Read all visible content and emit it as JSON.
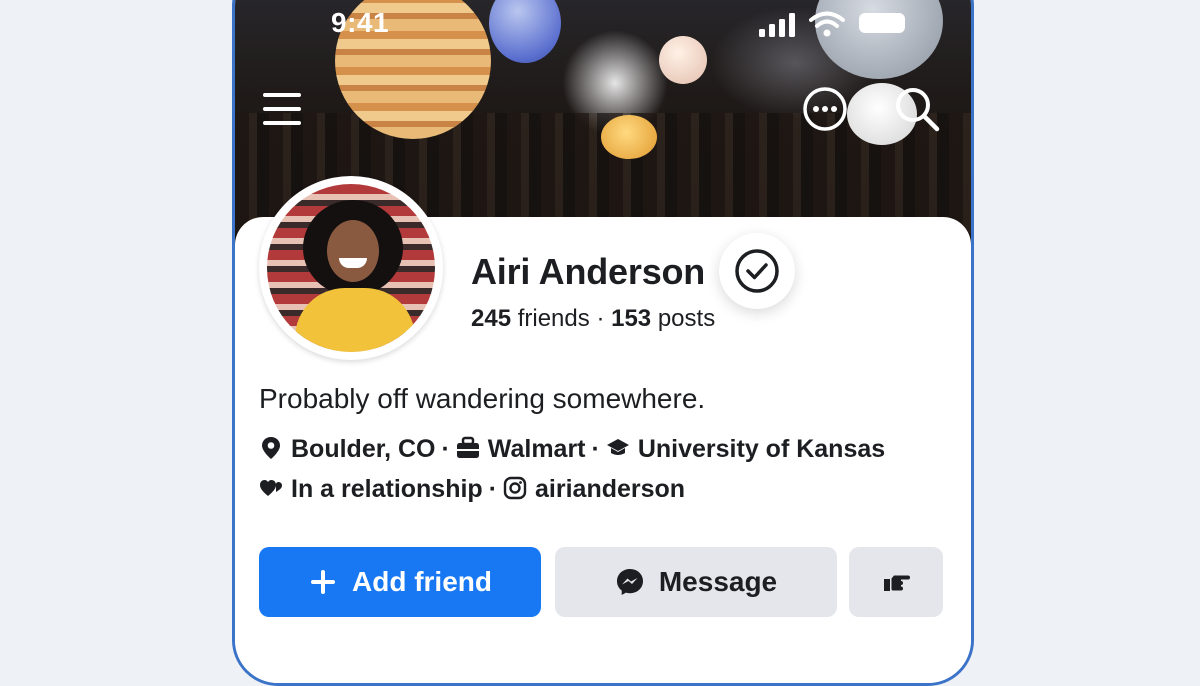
{
  "status_bar": {
    "time": "9:41"
  },
  "profile": {
    "name": "Airi Anderson",
    "friends_count": "245",
    "friends_label": "friends",
    "separator": "·",
    "posts_count": "153",
    "posts_label": "posts",
    "bio": "Probably off wandering somewhere.",
    "details": {
      "location": "Boulder, CO",
      "work": "Walmart",
      "education": "University of Kansas",
      "relationship": "In a relationship",
      "instagram": "airianderson"
    }
  },
  "actions": {
    "add_friend_label": "Add friend",
    "message_label": "Message"
  },
  "icons": {
    "menu": "menu-icon",
    "more": "more-icon",
    "search": "search-icon",
    "verified": "verified-check-icon",
    "location": "location-pin-icon",
    "work": "briefcase-icon",
    "education": "graduation-cap-icon",
    "relationship": "hearts-icon",
    "instagram": "instagram-icon",
    "add": "plus-icon",
    "messenger": "messenger-icon",
    "poke": "poke-hand-icon"
  },
  "colors": {
    "primary": "#1877f2",
    "secondary_button": "#e4e6eb",
    "text": "#1c1e21",
    "phone_frame": "#3b73c8"
  }
}
